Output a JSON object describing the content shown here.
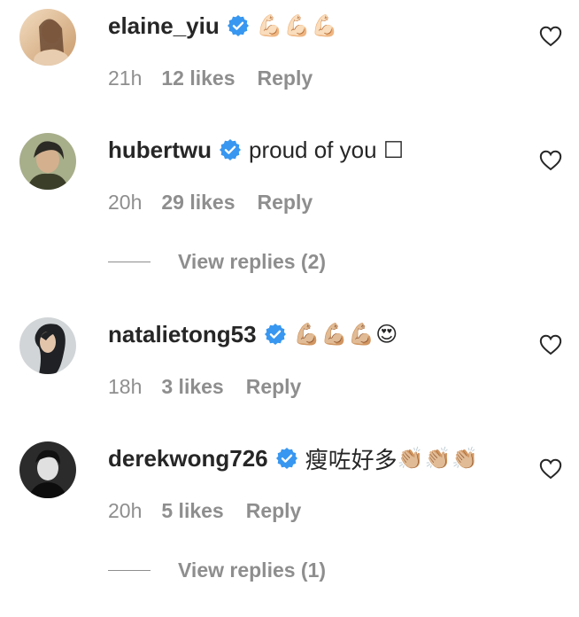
{
  "comments": [
    {
      "username": "elaine_yiu",
      "text": "",
      "emoji": "💪🏻💪🏻💪🏻",
      "time": "21h",
      "likes": "12 likes",
      "reply": "Reply",
      "avatar_colors": [
        "#e9c9a2",
        "#b88a5c"
      ],
      "view_replies": ""
    },
    {
      "username": "hubertwu",
      "text": "proud of you ☐",
      "emoji": "",
      "time": "20h",
      "likes": "29 likes",
      "reply": "Reply",
      "avatar_colors": [
        "#9aa57a",
        "#3b3f2a"
      ],
      "view_replies": "View replies (2)"
    },
    {
      "username": "natalietong53",
      "text": "",
      "emoji": "💪🏼💪🏼💪🏼😍",
      "time": "18h",
      "likes": "3 likes",
      "reply": "Reply",
      "avatar_colors": [
        "#c9cfd2",
        "#2a2c30"
      ],
      "view_replies": ""
    },
    {
      "username": "derekwong726",
      "text": "瘦咗好多",
      "emoji": "👏🏼👏🏼👏🏼",
      "time": "20h",
      "likes": "5 likes",
      "reply": "Reply",
      "avatar_colors": [
        "#3a3a3a",
        "#0d0d0d"
      ],
      "view_replies": "View replies (1)"
    }
  ],
  "colors": {
    "primary_text": "#262626",
    "secondary_text": "#8e8e8e",
    "verified_badge": "#3897f0"
  },
  "icons": {
    "verified": "verified-badge-icon",
    "like": "heart-outline-icon"
  }
}
